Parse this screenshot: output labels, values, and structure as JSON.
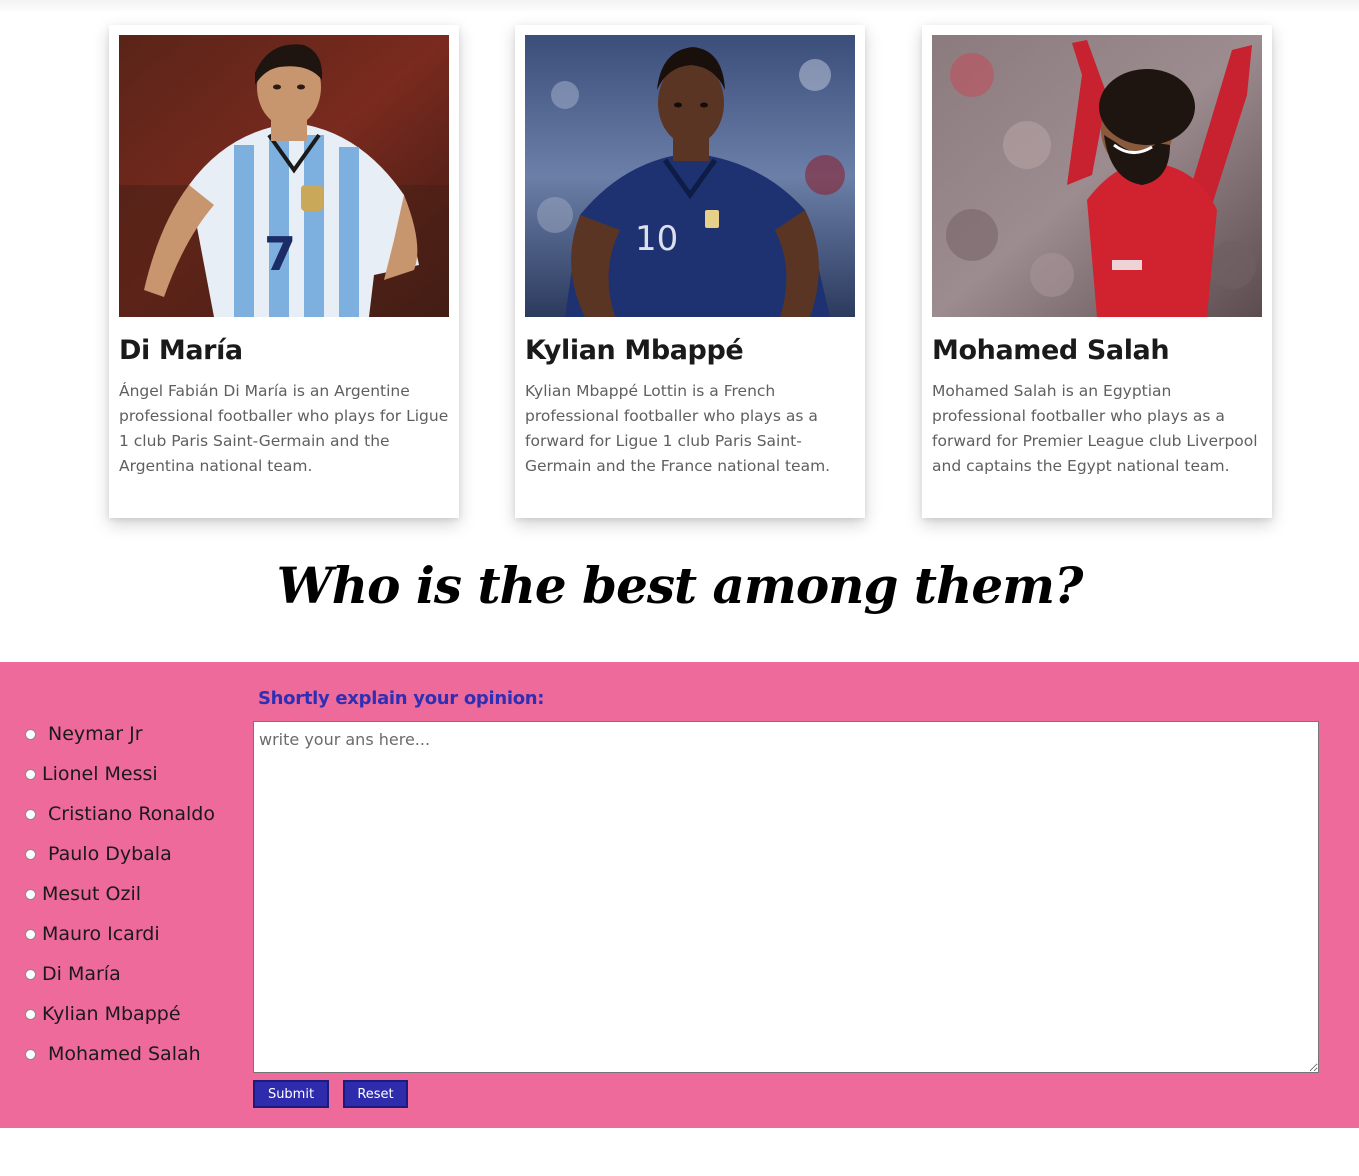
{
  "cards": [
    {
      "name": "Di María",
      "description": "Ángel Fabián Di María is an Argentine professional footballer who plays for Ligue 1 club Paris Saint-Germain and the Argentina national team.",
      "photo_icon": "player-photo-argentina-kit"
    },
    {
      "name": "Kylian Mbappé",
      "description": "Kylian Mbappé Lottin is a French professional footballer who plays as a forward for Ligue 1 club Paris Saint-Germain and the France national team.",
      "photo_icon": "player-photo-france-kit"
    },
    {
      "name": "Mohamed Salah",
      "description": "Mohamed Salah is an Egyptian professional footballer who plays as a forward for Premier League club Liverpool and captains the Egypt national team.",
      "photo_icon": "player-photo-liverpool-kit"
    }
  ],
  "question": "Who is the best among them?",
  "poll": {
    "options": [
      "Neymar Jr",
      "Lionel Messi",
      "Cristiano Ronaldo",
      "Paulo Dybala",
      "Mesut Ozil",
      "Mauro Icardi",
      "Di María",
      "Kylian Mbappé",
      "Mohamed Salah"
    ],
    "opinion_label": "Shortly explain your opinion:",
    "opinion_placeholder": "write your ans here...",
    "submit_label": "Submit",
    "reset_label": "Reset"
  },
  "colors": {
    "section_background": "#ee6a9a",
    "label_color": "#2f2fb5",
    "button_background": "#2e2cac"
  }
}
